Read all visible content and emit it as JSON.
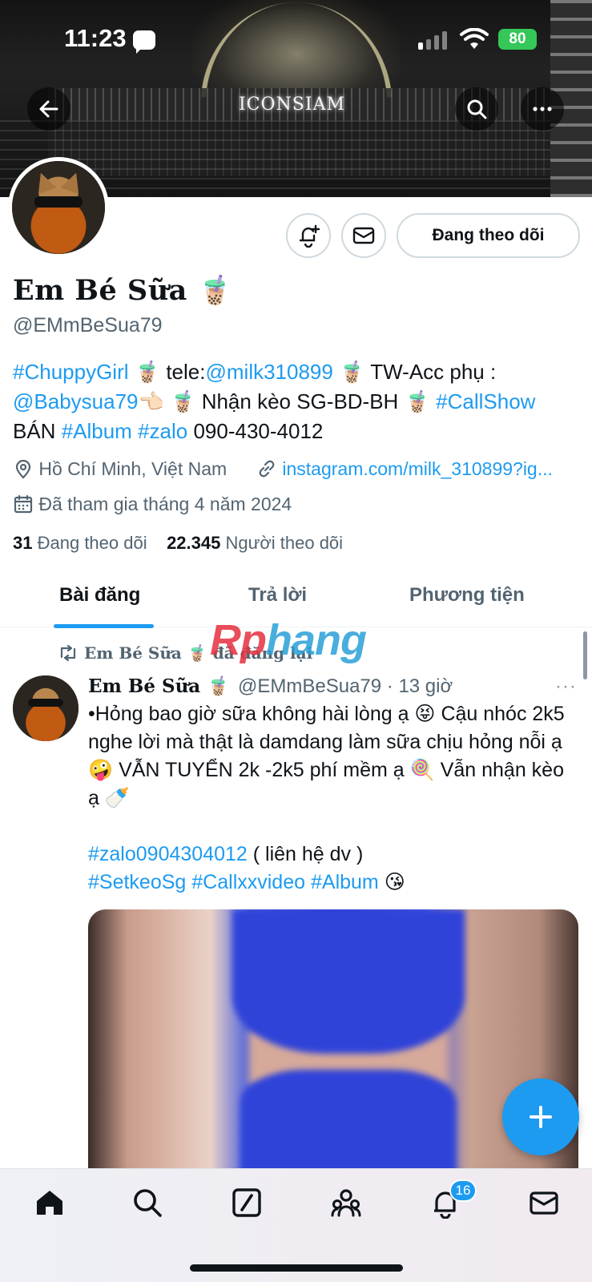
{
  "status_bar": {
    "time": "11:23",
    "battery": "80"
  },
  "banner": {
    "sign_text": "ICONSIAM"
  },
  "profile": {
    "display_name": "Em Bé Sữa 🧋",
    "handle": "@EMmBeSua79",
    "follow_button_label": "Đang theo dõi",
    "bio_segments": [
      {
        "text": "#ChuppyGirl",
        "link": true
      },
      {
        "text": " 🧋 tele:",
        "link": false
      },
      {
        "text": "@milk310899",
        "link": true
      },
      {
        "text": " 🧋 TW-Acc phụ : ",
        "link": false
      },
      {
        "text": "@Babysua79",
        "link": true
      },
      {
        "text": "👈🏻 🧋 Nhận kèo SG-BD-BH 🧋 ",
        "link": false
      },
      {
        "text": "#CallShow",
        "link": true
      },
      {
        "text": " BÁN ",
        "link": false
      },
      {
        "text": "#Album",
        "link": true
      },
      {
        "text": " ",
        "link": false
      },
      {
        "text": "#zalo",
        "link": true
      },
      {
        "text": " 090-430-4012",
        "link": false
      }
    ],
    "location": "Hồ Chí Minh, Việt Nam",
    "website": "instagram.com/milk_310899?ig...",
    "joined": "Đã tham gia tháng 4 năm 2024",
    "following_count": "31",
    "following_label": "Đang theo dõi",
    "followers_count": "22.345",
    "followers_label": "Người theo dõi"
  },
  "tabs": [
    {
      "label": "Bài đăng",
      "active": true
    },
    {
      "label": "Trả lời",
      "active": false
    },
    {
      "label": "Phương tiện",
      "active": false
    }
  ],
  "watermark": {
    "part1": "Rp",
    "part2": "hang"
  },
  "tweet": {
    "retweet_label": "Em Bé Sữa 🧋 đã đăng lại",
    "author_name": "Em Bé Sữa 🧋",
    "author_handle": "@EMmBeSua79 · 13 giờ",
    "more": "···",
    "text_segments": [
      {
        "text": "•Hỏng bao giờ sữa không hài lòng ạ 😝 Cậu nhóc 2k5 nghe lời mà thật là damdang làm sữa chịu hỏng nỗi ạ 🤪 VẪN TUYỂN 2k -2k5 phí mềm ạ 🍭 Vẫn nhận kèo ạ 🍼",
        "link": false,
        "br_after": 2
      },
      {
        "text": "#zalo0904304012",
        "link": true
      },
      {
        "text": " ( liên hệ dv )",
        "link": false,
        "br_after": 1
      },
      {
        "text": "#SetkeoSg",
        "link": true
      },
      {
        "text": " ",
        "link": false
      },
      {
        "text": "#Callxxvideo",
        "link": true
      },
      {
        "text": " ",
        "link": false
      },
      {
        "text": "#Album",
        "link": true
      },
      {
        "text": " 😘",
        "link": false
      }
    ]
  },
  "notifications_badge": "16",
  "icons": [
    "back-arrow-icon",
    "search-icon",
    "more-icon",
    "bell-plus-icon",
    "mail-icon",
    "location-icon",
    "link-icon",
    "calendar-icon",
    "retweet-icon",
    "home-icon",
    "compose-icon",
    "communities-icon",
    "notifications-icon"
  ],
  "colors": {
    "accent": "#1d9bf0",
    "text": "#0f1419",
    "muted": "#536471"
  }
}
